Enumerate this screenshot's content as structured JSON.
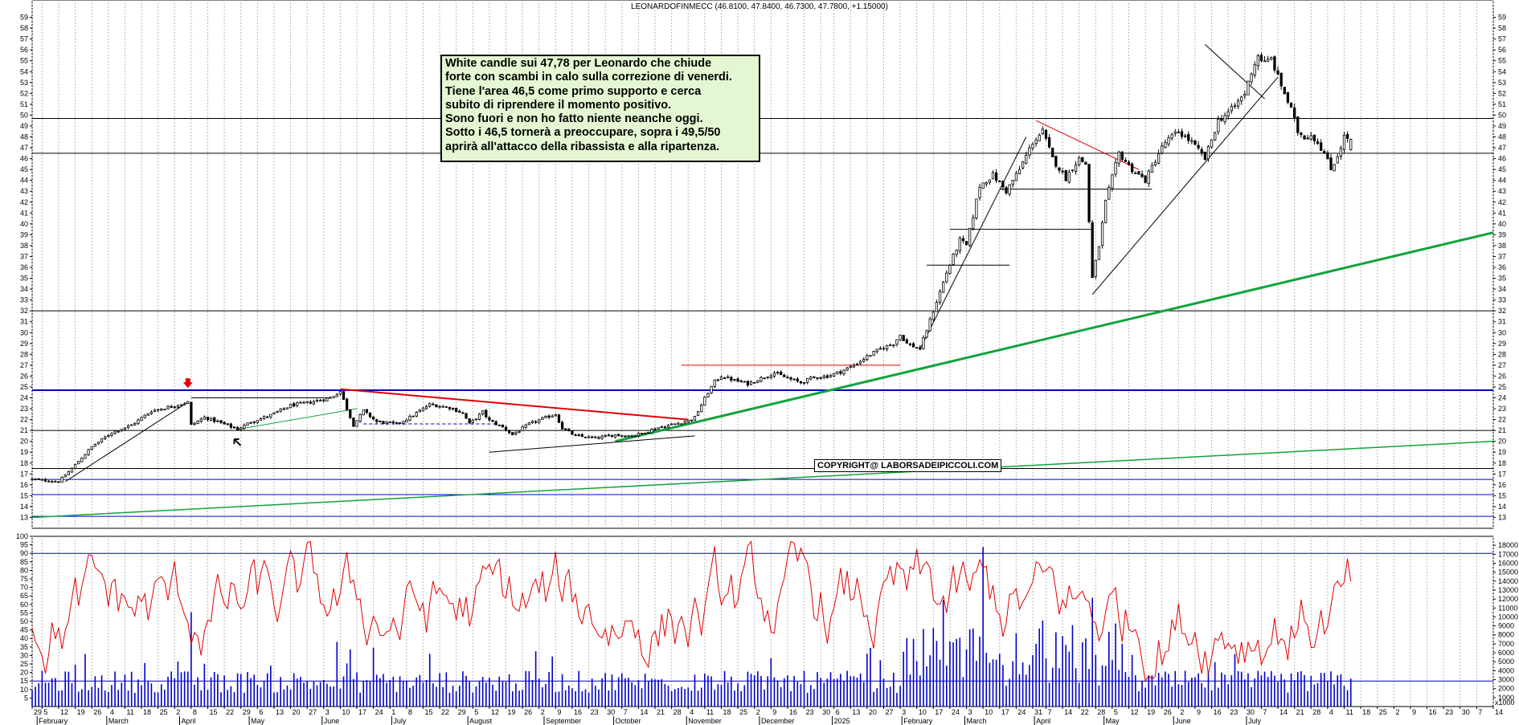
{
  "title": "LEONARDOFINMECC (46.8100, 47.8400, 46.7300, 47.7800, +1.15000)",
  "annotation": [
    "White candle sui 47,78 per Leonardo che chiude",
    "forte con scambi in calo sulla correzione di venerdi.",
    "Tiene l'area 46,5 come primo supporto e cerca",
    "subito di riprendere il momento positivo.",
    "Sono fuori e non ho fatto niente neanche oggi.",
    "Sotto i 46,5 tornerà a preoccupare, sopra i 49,5/50",
    "aprirà all'attacco della ribassista e alla ripartenza."
  ],
  "copyright": "COPYRIGHT@ LABORSADEIPICCOLI.COM",
  "volume_unit": "x1000",
  "chart_data": [
    {
      "type": "candlestick",
      "title": "LEONARDOFINMECC (46.8100, 47.8400, 46.7300, 47.7800, +1.15000)",
      "last_bar": {
        "open": 46.81,
        "high": 47.84,
        "low": 46.73,
        "close": 47.78,
        "change": 1.15
      },
      "ylim": [
        12,
        60
      ],
      "y_ticks": [
        13,
        14,
        15,
        16,
        17,
        18,
        19,
        20,
        21,
        22,
        23,
        24,
        25,
        26,
        27,
        28,
        29,
        30,
        31,
        32,
        33,
        34,
        35,
        36,
        37,
        38,
        39,
        40,
        41,
        42,
        43,
        44,
        45,
        46,
        47,
        48,
        49,
        50,
        51,
        52,
        53,
        54,
        55,
        56,
        57,
        58,
        59
      ],
      "x_labels": [
        {
          "t": 0,
          "label": "29"
        },
        {
          "t": 3,
          "label": "5"
        },
        {
          "t": 8,
          "label": "12"
        },
        {
          "t": 13,
          "label": "19"
        },
        {
          "t": 18,
          "label": "26"
        },
        {
          "t": 23,
          "label": "4"
        },
        {
          "t": 28,
          "label": "11"
        },
        {
          "t": 33,
          "label": "18"
        },
        {
          "t": 38,
          "label": "25"
        },
        {
          "t": 43,
          "label": "2"
        },
        {
          "t": 48,
          "label": "8"
        },
        {
          "t": 53,
          "label": "15"
        },
        {
          "t": 58,
          "label": "22"
        },
        {
          "t": 63,
          "label": "29"
        },
        {
          "t": 68,
          "label": "6"
        },
        {
          "t": 73,
          "label": "13"
        },
        {
          "t": 78,
          "label": "20"
        },
        {
          "t": 83,
          "label": "27"
        },
        {
          "t": 88,
          "label": "3"
        },
        {
          "t": 93,
          "label": "10"
        },
        {
          "t": 98,
          "label": "17"
        },
        {
          "t": 103,
          "label": "24"
        },
        {
          "t": 108,
          "label": "1"
        },
        {
          "t": 113,
          "label": "8"
        },
        {
          "t": 118,
          "label": "15"
        },
        {
          "t": 123,
          "label": "22"
        },
        {
          "t": 128,
          "label": "29"
        },
        {
          "t": 133,
          "label": "5"
        },
        {
          "t": 138,
          "label": "12"
        },
        {
          "t": 143,
          "label": "19"
        },
        {
          "t": 148,
          "label": "26"
        },
        {
          "t": 153,
          "label": "2"
        },
        {
          "t": 158,
          "label": "9"
        },
        {
          "t": 163,
          "label": "16"
        },
        {
          "t": 168,
          "label": "23"
        },
        {
          "t": 173,
          "label": "30"
        },
        {
          "t": 178,
          "label": "7"
        },
        {
          "t": 183,
          "label": "14"
        },
        {
          "t": 188,
          "label": "21"
        },
        {
          "t": 193,
          "label": "28"
        },
        {
          "t": 198,
          "label": "4"
        },
        {
          "t": 203,
          "label": "11"
        },
        {
          "t": 208,
          "label": "18"
        },
        {
          "t": 213,
          "label": "25"
        },
        {
          "t": 218,
          "label": "2"
        },
        {
          "t": 223,
          "label": "9"
        },
        {
          "t": 228,
          "label": "16"
        },
        {
          "t": 233,
          "label": "23"
        },
        {
          "t": 238,
          "label": "30"
        },
        {
          "t": 242,
          "label": "6"
        },
        {
          "t": 247,
          "label": "13"
        },
        {
          "t": 252,
          "label": "20"
        },
        {
          "t": 257,
          "label": "27"
        },
        {
          "t": 262,
          "label": "3"
        },
        {
          "t": 267,
          "label": "10"
        },
        {
          "t": 272,
          "label": "17"
        },
        {
          "t": 277,
          "label": "24"
        },
        {
          "t": 282,
          "label": "3"
        },
        {
          "t": 287,
          "label": "10"
        },
        {
          "t": 292,
          "label": "17"
        },
        {
          "t": 297,
          "label": "24"
        },
        {
          "t": 302,
          "label": "31"
        },
        {
          "t": 306,
          "label": "7"
        },
        {
          "t": 311,
          "label": "14"
        },
        {
          "t": 316,
          "label": "22"
        },
        {
          "t": 321,
          "label": "28"
        },
        {
          "t": 326,
          "label": "5"
        },
        {
          "t": 331,
          "label": "12"
        },
        {
          "t": 336,
          "label": "19"
        },
        {
          "t": 341,
          "label": "26"
        },
        {
          "t": 346,
          "label": "2"
        },
        {
          "t": 351,
          "label": "9"
        },
        {
          "t": 356,
          "label": "16"
        },
        {
          "t": 361,
          "label": "23"
        },
        {
          "t": 366,
          "label": "30"
        },
        {
          "t": 371,
          "label": "7"
        },
        {
          "t": 376,
          "label": "14"
        },
        {
          "t": 381,
          "label": "21"
        },
        {
          "t": 386,
          "label": "28"
        },
        {
          "t": 391,
          "label": "4"
        },
        {
          "t": 396,
          "label": "11"
        },
        {
          "t": 401,
          "label": "18"
        },
        {
          "t": 406,
          "label": "25"
        },
        {
          "t": 411,
          "label": "2"
        },
        {
          "t": 416,
          "label": "9"
        },
        {
          "t": 421,
          "label": "16"
        },
        {
          "t": 426,
          "label": "23"
        },
        {
          "t": 431,
          "label": "30"
        },
        {
          "t": 436,
          "label": "7"
        },
        {
          "t": 441,
          "label": "14"
        }
      ],
      "month_labels": [
        {
          "t": 2,
          "label": "February"
        },
        {
          "t": 23,
          "label": "March"
        },
        {
          "t": 45,
          "label": "April"
        },
        {
          "t": 66,
          "label": "May"
        },
        {
          "t": 88,
          "label": "June"
        },
        {
          "t": 109,
          "label": "July"
        },
        {
          "t": 132,
          "label": "August"
        },
        {
          "t": 155,
          "label": "September"
        },
        {
          "t": 176,
          "label": "October"
        },
        {
          "t": 198,
          "label": "November"
        },
        {
          "t": 220,
          "label": "December"
        },
        {
          "t": 242,
          "label": "2025"
        },
        {
          "t": 263,
          "label": "February"
        },
        {
          "t": 282,
          "label": "March"
        },
        {
          "t": 303,
          "label": "April"
        },
        {
          "t": 324,
          "label": "May"
        },
        {
          "t": 345,
          "label": "June"
        },
        {
          "t": 367,
          "label": "July"
        }
      ],
      "price_path": [
        [
          0,
          16.5
        ],
        [
          8,
          16.3
        ],
        [
          12,
          17.5
        ],
        [
          18,
          19.5
        ],
        [
          24,
          20.8
        ],
        [
          30,
          21.5
        ],
        [
          36,
          22.8
        ],
        [
          42,
          23.2
        ],
        [
          47,
          23.6
        ],
        [
          48,
          21.5
        ],
        [
          52,
          22.2
        ],
        [
          56,
          21.8
        ],
        [
          62,
          21.1
        ],
        [
          66,
          21.8
        ],
        [
          72,
          22.4
        ],
        [
          78,
          23.3
        ],
        [
          84,
          23.6
        ],
        [
          90,
          24.0
        ],
        [
          93,
          24.6
        ],
        [
          95,
          23.0
        ],
        [
          97,
          21.5
        ],
        [
          100,
          22.8
        ],
        [
          104,
          21.8
        ],
        [
          110,
          21.6
        ],
        [
          114,
          22.2
        ],
        [
          120,
          23.4
        ],
        [
          126,
          23.1
        ],
        [
          130,
          22.6
        ],
        [
          132,
          21.6
        ],
        [
          136,
          22.7
        ],
        [
          138,
          21.9
        ],
        [
          142,
          21.3
        ],
        [
          145,
          20.6
        ],
        [
          150,
          21.6
        ],
        [
          156,
          22.3
        ],
        [
          158,
          22.5
        ],
        [
          160,
          21.2
        ],
        [
          164,
          20.5
        ],
        [
          170,
          20.3
        ],
        [
          176,
          20.6
        ],
        [
          180,
          20.5
        ],
        [
          184,
          20.7
        ],
        [
          188,
          21.2
        ],
        [
          194,
          21.6
        ],
        [
          198,
          21.9
        ],
        [
          200,
          22.2
        ],
        [
          204,
          24.5
        ],
        [
          206,
          25.5
        ],
        [
          208,
          26.0
        ],
        [
          212,
          25.6
        ],
        [
          216,
          25.3
        ],
        [
          220,
          25.8
        ],
        [
          224,
          26.3
        ],
        [
          228,
          25.8
        ],
        [
          232,
          25.4
        ],
        [
          236,
          25.9
        ],
        [
          240,
          26.0
        ],
        [
          244,
          26.4
        ],
        [
          248,
          27.0
        ],
        [
          252,
          27.8
        ],
        [
          256,
          28.5
        ],
        [
          260,
          29.0
        ],
        [
          262,
          29.8
        ],
        [
          264,
          29.0
        ],
        [
          268,
          28.5
        ],
        [
          272,
          32.0
        ],
        [
          276,
          35.5
        ],
        [
          280,
          38.5
        ],
        [
          282,
          38.0
        ],
        [
          286,
          43.5
        ],
        [
          290,
          44.5
        ],
        [
          294,
          43.0
        ],
        [
          298,
          45.0
        ],
        [
          302,
          47.5
        ],
        [
          305,
          48.5
        ],
        [
          308,
          46.0
        ],
        [
          312,
          44.2
        ],
        [
          314,
          45.2
        ],
        [
          316,
          46.0
        ],
        [
          318,
          45.5
        ],
        [
          320,
          35.0
        ],
        [
          322,
          38.0
        ],
        [
          324,
          42.0
        ],
        [
          328,
          46.5
        ],
        [
          332,
          45.0
        ],
        [
          336,
          44.0
        ],
        [
          340,
          46.5
        ],
        [
          342,
          47.5
        ],
        [
          346,
          48.5
        ],
        [
          350,
          47.5
        ],
        [
          354,
          46.0
        ],
        [
          358,
          49.5
        ],
        [
          362,
          50.5
        ],
        [
          366,
          52.0
        ],
        [
          368,
          54.0
        ],
        [
          370,
          55.5
        ],
        [
          372,
          54.8
        ],
        [
          374,
          55.2
        ],
        [
          376,
          53.5
        ],
        [
          378,
          52.0
        ],
        [
          380,
          50.5
        ],
        [
          382,
          48.5
        ],
        [
          384,
          48.0
        ],
        [
          386,
          48.2
        ],
        [
          388,
          47.5
        ],
        [
          390,
          46.5
        ],
        [
          392,
          45.0
        ],
        [
          394,
          46.3
        ],
        [
          396,
          48.0
        ],
        [
          398,
          47.78
        ]
      ],
      "series": [
        {
          "name": "",
          "kind": "oscillator",
          "color": "#e00000",
          "ylim": [
            0,
            100
          ],
          "ticks": [
            5,
            10,
            15,
            20,
            25,
            30,
            35,
            40,
            45,
            50,
            55,
            60,
            65,
            70,
            75,
            80,
            85,
            90,
            95,
            100
          ]
        },
        {
          "name": "",
          "kind": "volume",
          "color": "#0000c8",
          "unit": "x1000",
          "ticks": [
            1000,
            2000,
            3000,
            4000,
            5000,
            6000,
            7000,
            8000,
            9000,
            10000,
            11000,
            12000,
            13000,
            14000,
            15000,
            16000,
            17000,
            18000
          ]
        }
      ],
      "levels": [
        {
          "y": 24.7,
          "color": "#0000cc"
        },
        {
          "y": 32.0,
          "color": "#000000"
        },
        {
          "y": 46.5,
          "color": "#000000"
        },
        {
          "y": 49.7,
          "color": "#000000"
        },
        {
          "y": 21.0,
          "color": "#000000"
        },
        {
          "y": 17.5,
          "color": "#000000"
        },
        {
          "y": 16.5,
          "color": "#0000cc"
        },
        {
          "y": 15.1,
          "color": "#0000cc"
        },
        {
          "y": 13.1,
          "color": "#0000cc"
        }
      ]
    }
  ]
}
